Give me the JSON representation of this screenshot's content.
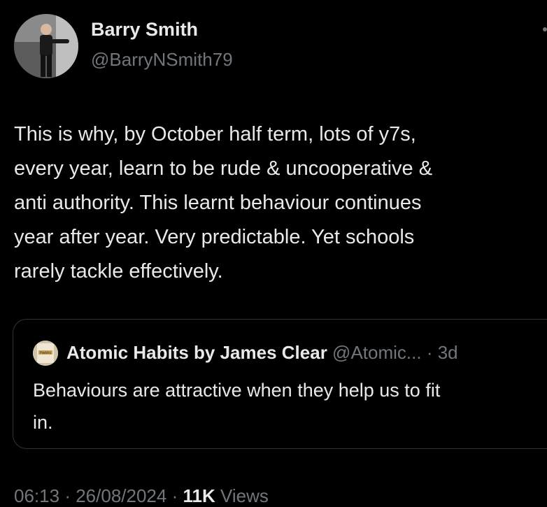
{
  "author": {
    "name": "Barry Smith",
    "handle": "@BarryNSmith79"
  },
  "tweet": {
    "lines": [
      "This is why, by October half term, lots of y7s,",
      "every year, learn to be rude & uncooperative &",
      "anti authority. This learnt behaviour continues",
      "year after year. Very predictable. Yet schools",
      "rarely tackle effectively."
    ]
  },
  "quoted": {
    "name": "Atomic Habits by James Clear",
    "handle": "@Atomic...",
    "separator": "·",
    "time": "3d",
    "avatar_text": "Habits",
    "lines": [
      "Behaviours are attractive when they help us to fit",
      "in."
    ]
  },
  "meta": {
    "time": "06:13",
    "separator": "·",
    "date": "26/08/2024",
    "views_count": "11K",
    "views_label": "Views"
  },
  "icons": {
    "more": "more-options-icon"
  },
  "colors": {
    "background": "#000000",
    "text_primary": "#e7e9ea",
    "text_secondary": "#71767b",
    "border": "#2f3336"
  }
}
